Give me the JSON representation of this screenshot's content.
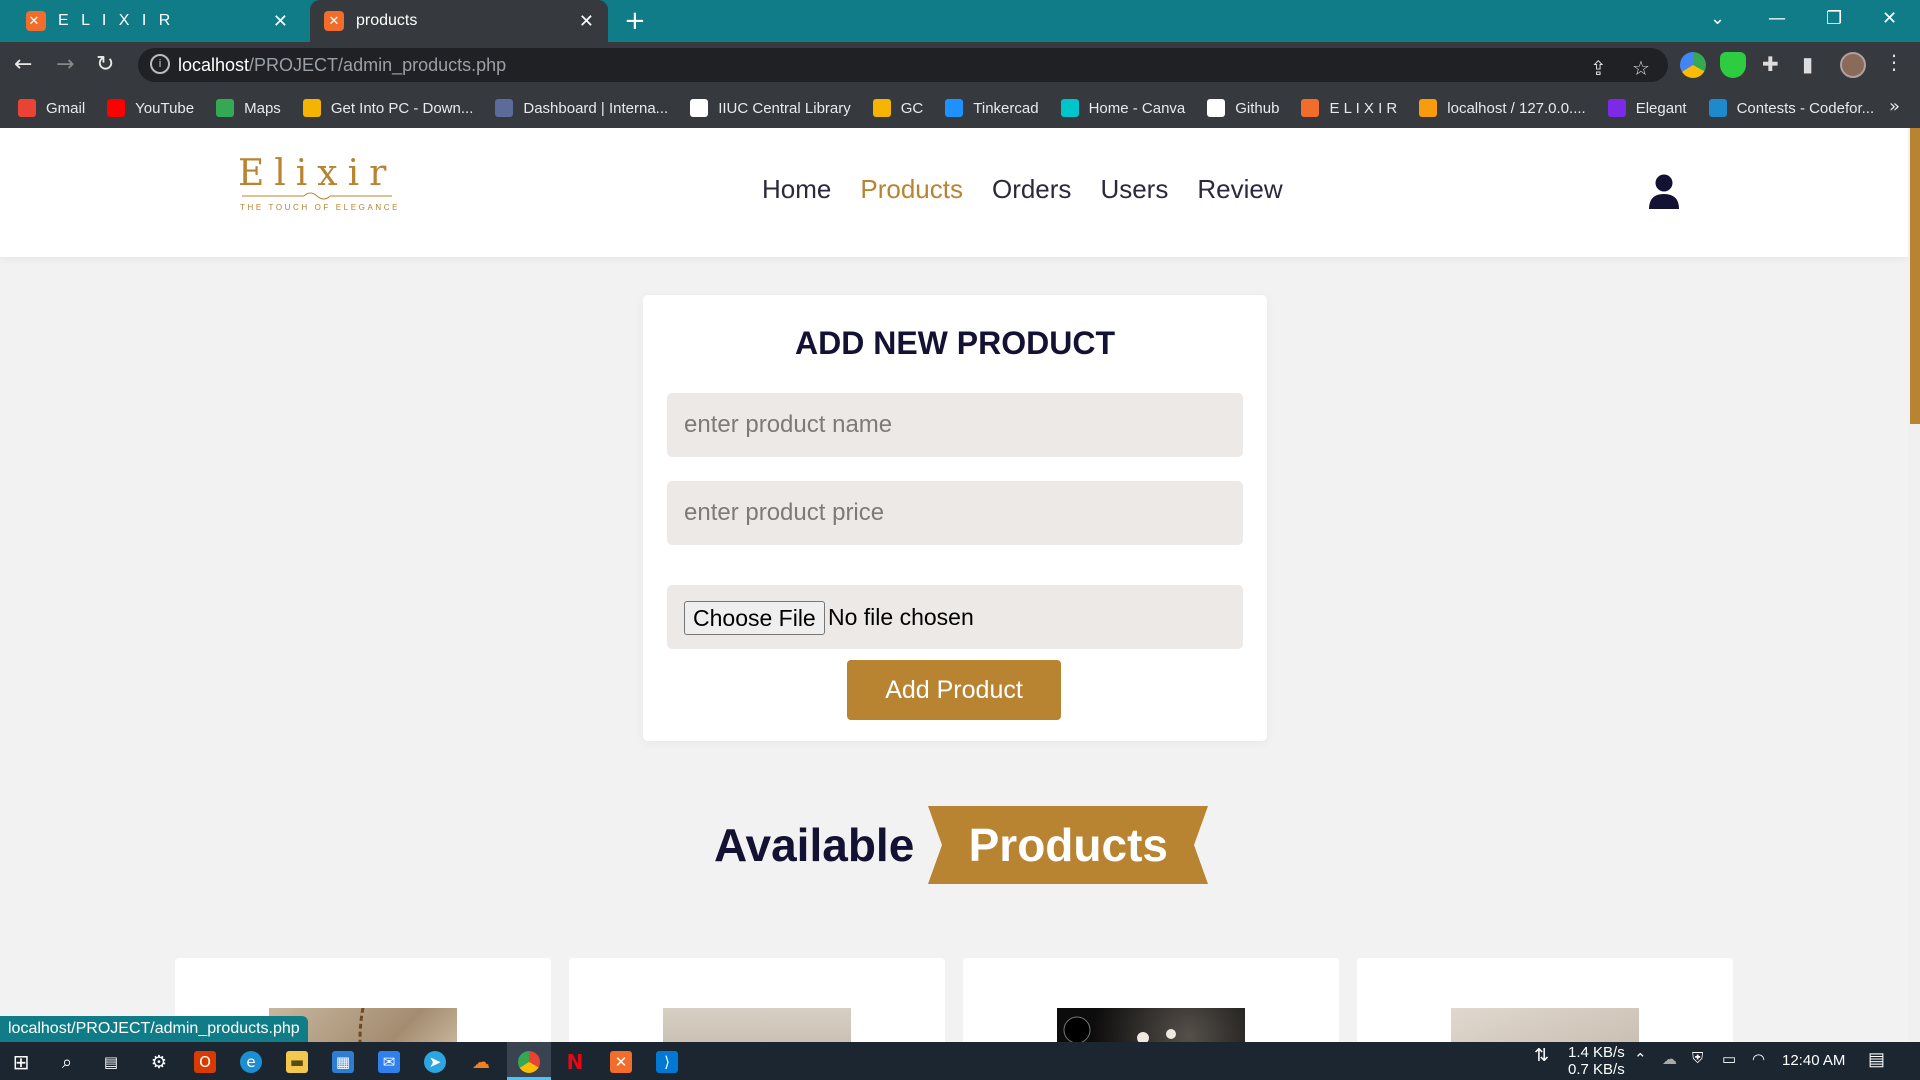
{
  "browser": {
    "tabs": [
      {
        "label": "E L I X I R",
        "active": false
      },
      {
        "label": "products",
        "active": true
      }
    ],
    "url_host": "localhost",
    "url_path": "/PROJECT/admin_products.php",
    "bookmarks": [
      {
        "label": "Gmail",
        "icon": "gmail-icon",
        "color": "#ea4335"
      },
      {
        "label": "YouTube",
        "icon": "youtube-icon",
        "color": "#ff0000"
      },
      {
        "label": "Maps",
        "icon": "maps-icon",
        "color": "#34a853"
      },
      {
        "label": "Get Into PC - Down...",
        "icon": "getintopc-icon",
        "color": "#f4b400"
      },
      {
        "label": "Dashboard | Interna...",
        "icon": "dashboard-icon",
        "color": "#5b6b9a"
      },
      {
        "label": "IIUC Central Library",
        "icon": "library-icon",
        "color": "#ffffff"
      },
      {
        "label": "GC",
        "icon": "classroom-icon",
        "color": "#f4b400"
      },
      {
        "label": "Tinkercad",
        "icon": "tinkercad-icon",
        "color": "#1e90ff"
      },
      {
        "label": "Home - Canva",
        "icon": "canva-icon",
        "color": "#00c4cc"
      },
      {
        "label": "Github",
        "icon": "github-icon",
        "color": "#ffffff"
      },
      {
        "label": "E L I X I R",
        "icon": "xampp-icon",
        "color": "#f26d2b"
      },
      {
        "label": "localhost / 127.0.0....",
        "icon": "phpmyadmin-icon",
        "color": "#f89c0e"
      },
      {
        "label": "Elegant",
        "icon": "canva-icon",
        "color": "#7d2ae8"
      },
      {
        "label": "Contests - Codefor...",
        "icon": "codeforces-icon",
        "color": "#1f8acb"
      }
    ],
    "more_glyph": "»",
    "status_url": "localhost/PROJECT/admin_products.php"
  },
  "site": {
    "logo_text": "Elixir",
    "logo_tagline": "THE TOUCH OF ELEGANCE",
    "nav": [
      {
        "label": "Home",
        "active": false
      },
      {
        "label": "Products",
        "active": true
      },
      {
        "label": "Orders",
        "active": false
      },
      {
        "label": "Users",
        "active": false
      },
      {
        "label": "Review",
        "active": false
      }
    ],
    "accent_color": "#b88431",
    "dark_color": "#141233"
  },
  "form": {
    "title": "ADD NEW PRODUCT",
    "name_placeholder": "enter product name",
    "price_placeholder": "enter product price",
    "file_button": "Choose File",
    "file_status": "No file chosen",
    "submit_label": "Add Product"
  },
  "section": {
    "title_plain": "Available",
    "title_ribbon": "Products"
  },
  "products": [
    {
      "image": "gold-chain-jewelry"
    },
    {
      "image": "jewelry-on-fabric"
    },
    {
      "image": "pearl-jewelry-dark"
    },
    {
      "image": "jewelry-on-fabric"
    }
  ],
  "taskbar": {
    "net_down": "1.4 KB/s",
    "net_up": "0.7 KB/s",
    "clock": "12:40 AM"
  }
}
